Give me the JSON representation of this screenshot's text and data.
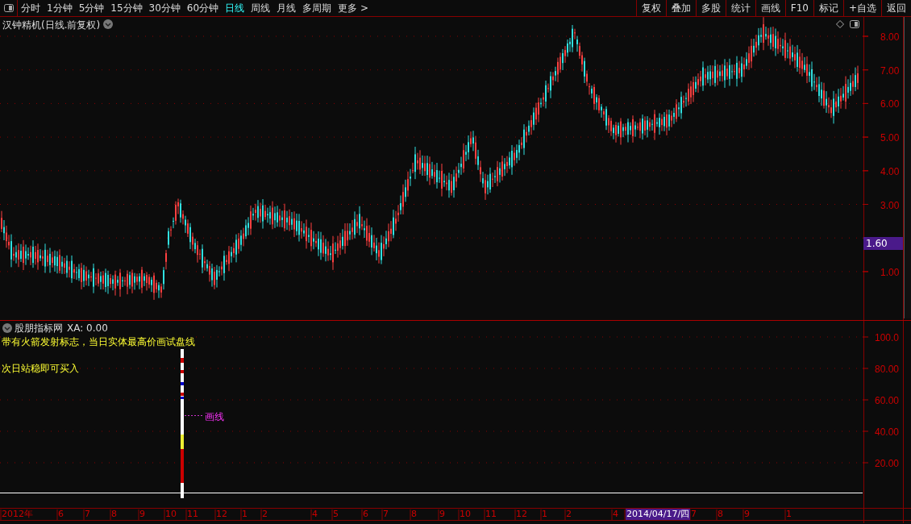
{
  "toolbar": {
    "periods": [
      {
        "label": "分时",
        "selected": false
      },
      {
        "label": "1分钟",
        "selected": false
      },
      {
        "label": "5分钟",
        "selected": false
      },
      {
        "label": "15分钟",
        "selected": false
      },
      {
        "label": "30分钟",
        "selected": false
      },
      {
        "label": "60分钟",
        "selected": false
      },
      {
        "label": "日线",
        "selected": true
      },
      {
        "label": "周线",
        "selected": false
      },
      {
        "label": "月线",
        "selected": false
      },
      {
        "label": "多周期",
        "selected": false
      },
      {
        "label": "更多 >",
        "selected": false
      }
    ],
    "actions": [
      "复权",
      "叠加",
      "多股",
      "统计",
      "画线",
      "F10",
      "标记",
      "+自选",
      "返回"
    ]
  },
  "main_chart": {
    "title": "汉钟精机(日线.前复权)",
    "price_axis": [
      "8.00",
      "7.00",
      "6.00",
      "5.00",
      "4.00",
      "3.00",
      "1.00"
    ],
    "current_price": "1.60"
  },
  "indicator": {
    "name": "股朋指标网",
    "reading": "XA: 0.00",
    "notes": [
      "带有火箭发射标志，当日实体最高价画试盘线",
      "次日站稳即可买入"
    ],
    "line_label": "画线",
    "axis": [
      "100.0",
      "80.00",
      "60.00",
      "40.00",
      "20.00"
    ]
  },
  "time_axis": [
    {
      "label": "2012年",
      "highlighted": false
    },
    {
      "label": "6",
      "highlighted": false
    },
    {
      "label": "7",
      "highlighted": false
    },
    {
      "label": "8",
      "highlighted": false
    },
    {
      "label": "9",
      "highlighted": false
    },
    {
      "label": "10",
      "highlighted": false
    },
    {
      "label": "11",
      "highlighted": false
    },
    {
      "label": "12",
      "highlighted": false
    },
    {
      "label": "1",
      "highlighted": false
    },
    {
      "label": "2",
      "highlighted": false
    },
    {
      "label": "4",
      "highlighted": false
    },
    {
      "label": "5",
      "highlighted": false
    },
    {
      "label": "6",
      "highlighted": false
    },
    {
      "label": "7",
      "highlighted": false
    },
    {
      "label": "8",
      "highlighted": false
    },
    {
      "label": "9",
      "highlighted": false
    },
    {
      "label": "10",
      "highlighted": false
    },
    {
      "label": "11",
      "highlighted": false
    },
    {
      "label": "12",
      "highlighted": false
    },
    {
      "label": "1",
      "highlighted": false
    },
    {
      "label": "2",
      "highlighted": false
    },
    {
      "label": "4",
      "highlighted": false
    },
    {
      "label": "2014/04/17/四",
      "highlighted": true
    },
    {
      "label": "7",
      "highlighted": false
    },
    {
      "label": "8",
      "highlighted": false
    },
    {
      "label": "9",
      "highlighted": false
    },
    {
      "label": "1",
      "highlighted": false
    }
  ]
}
